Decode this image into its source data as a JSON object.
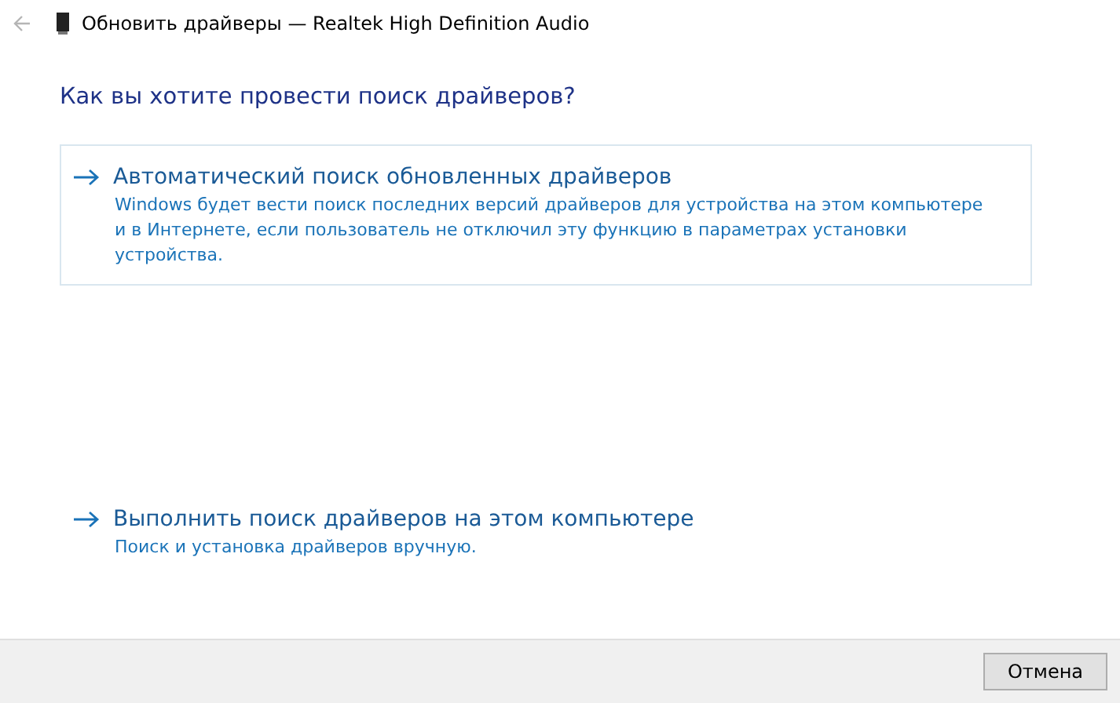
{
  "window": {
    "title": "Обновить драйверы — Realtek High Definition Audio"
  },
  "heading": "Как вы хотите провести поиск драйверов?",
  "options": [
    {
      "title": "Автоматический поиск обновленных драйверов",
      "description": "Windows будет вести поиск последних версий драйверов для устройства на этом компьютере и в Интернете, если пользователь не отключил эту функцию в параметрах установки устройства.",
      "selected": true
    },
    {
      "title": "Выполнить поиск драйверов на этом компьютере",
      "description": "Поиск и установка драйверов вручную.",
      "selected": false
    }
  ],
  "buttons": [
    "Отмена"
  ]
}
